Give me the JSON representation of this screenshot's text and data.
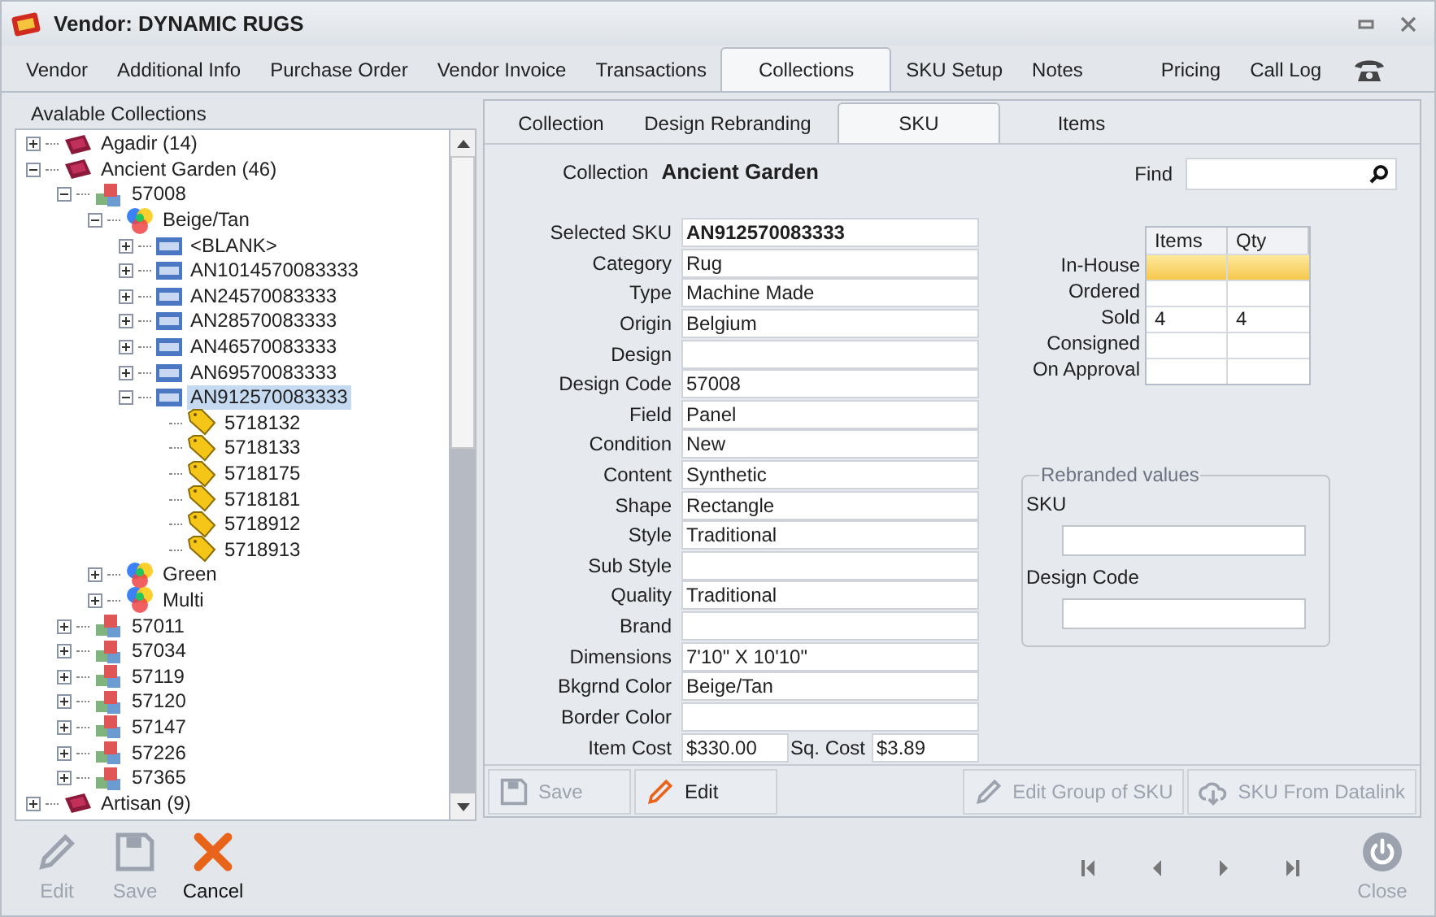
{
  "window": {
    "title": "Vendor: DYNAMIC RUGS"
  },
  "tabs": [
    {
      "label": "Vendor",
      "selected": false
    },
    {
      "label": "Additional Info",
      "selected": false
    },
    {
      "label": "Purchase Order",
      "selected": false
    },
    {
      "label": "Vendor Invoice",
      "selected": false
    },
    {
      "label": "Transactions",
      "selected": false
    },
    {
      "label": "Collections",
      "selected": true
    },
    {
      "label": "SKU Setup",
      "selected": false
    },
    {
      "label": "Notes",
      "selected": false
    },
    {
      "label": "Pricing",
      "selected": false
    },
    {
      "label": "Call Log",
      "selected": false
    }
  ],
  "tree": {
    "title": "Avalable Collections",
    "items": [
      {
        "kind": "collection",
        "label": "Agadir (14)",
        "expanded": false,
        "selected": false
      },
      {
        "kind": "collection",
        "label": "Ancient Garden (46)",
        "expanded": true,
        "selected": false,
        "children": [
          {
            "kind": "design",
            "label": "57008",
            "expanded": true,
            "selected": false,
            "children": [
              {
                "kind": "color",
                "label": "Beige/Tan",
                "expanded": true,
                "selected": false,
                "children": [
                  {
                    "kind": "sku",
                    "label": "<BLANK>",
                    "expanded": false,
                    "selected": false
                  },
                  {
                    "kind": "sku",
                    "label": "AN1014570083333",
                    "expanded": false,
                    "selected": false
                  },
                  {
                    "kind": "sku",
                    "label": "AN24570083333",
                    "expanded": false,
                    "selected": false
                  },
                  {
                    "kind": "sku",
                    "label": "AN28570083333",
                    "expanded": false,
                    "selected": false
                  },
                  {
                    "kind": "sku",
                    "label": "AN46570083333",
                    "expanded": false,
                    "selected": false
                  },
                  {
                    "kind": "sku",
                    "label": "AN69570083333",
                    "expanded": false,
                    "selected": false
                  },
                  {
                    "kind": "sku",
                    "label": "AN912570083333",
                    "expanded": true,
                    "selected": true,
                    "children": [
                      {
                        "kind": "item",
                        "label": "5718132",
                        "selected": false
                      },
                      {
                        "kind": "item",
                        "label": "5718133",
                        "selected": false
                      },
                      {
                        "kind": "item",
                        "label": "5718175",
                        "selected": false
                      },
                      {
                        "kind": "item",
                        "label": "5718181",
                        "selected": false
                      },
                      {
                        "kind": "item",
                        "label": "5718912",
                        "selected": false
                      },
                      {
                        "kind": "item",
                        "label": "5718913",
                        "selected": false
                      }
                    ]
                  }
                ]
              },
              {
                "kind": "color",
                "label": "Green",
                "expanded": false,
                "selected": false
              },
              {
                "kind": "color",
                "label": "Multi",
                "expanded": false,
                "selected": false
              }
            ]
          },
          {
            "kind": "design",
            "label": "57011",
            "expanded": false,
            "selected": false
          },
          {
            "kind": "design",
            "label": "57034",
            "expanded": false,
            "selected": false
          },
          {
            "kind": "design",
            "label": "57119",
            "expanded": false,
            "selected": false
          },
          {
            "kind": "design",
            "label": "57120",
            "expanded": false,
            "selected": false
          },
          {
            "kind": "design",
            "label": "57147",
            "expanded": false,
            "selected": false
          },
          {
            "kind": "design",
            "label": "57226",
            "expanded": false,
            "selected": false
          },
          {
            "kind": "design",
            "label": "57365",
            "expanded": false,
            "selected": false
          }
        ]
      },
      {
        "kind": "collection",
        "label": "Artisan (9)",
        "expanded": false,
        "selected": false
      }
    ]
  },
  "subtabs": [
    {
      "label": "Collection",
      "selected": false
    },
    {
      "label": "Design Rebranding",
      "selected": false
    },
    {
      "label": "SKU",
      "selected": true
    },
    {
      "label": "Items",
      "selected": false
    }
  ],
  "collection": {
    "label": "Collection",
    "value": "Ancient Garden"
  },
  "find": {
    "label": "Find"
  },
  "fields": [
    {
      "label": "Selected SKU",
      "value": "AN912570083333",
      "bold": true
    },
    {
      "label": "Category",
      "value": "Rug"
    },
    {
      "label": "Type",
      "value": "Machine Made"
    },
    {
      "label": "Origin",
      "value": "Belgium"
    },
    {
      "label": "Design"
    },
    {
      "label": "Design Code",
      "value": "57008"
    },
    {
      "label": "Field",
      "value": "Panel"
    },
    {
      "label": "Condition",
      "value": "New"
    },
    {
      "label": "Content",
      "value": "Synthetic"
    },
    {
      "label": "Shape",
      "value": "Rectangle"
    },
    {
      "label": "Style",
      "value": "Traditional"
    },
    {
      "label": "Sub Style"
    },
    {
      "label": "Quality",
      "value": "Traditional"
    },
    {
      "label": "Brand"
    },
    {
      "label": "Dimensions",
      "value": "7'10\" X 10'10\""
    },
    {
      "label": "Bkgrnd Color",
      "value": "Beige/Tan"
    },
    {
      "label": "Border Color"
    }
  ],
  "costs": [
    {
      "label": "Item Cost",
      "value": "$330.00"
    },
    {
      "label": "Sq. Cost",
      "value": "$3.89"
    }
  ],
  "stock": {
    "columns": [
      "Items",
      "Qty"
    ],
    "rows": [
      {
        "label": "In-House",
        "selected": true
      },
      {
        "label": "Ordered",
        "selected": false
      },
      {
        "label": "Sold",
        "items": "4",
        "qty": "4",
        "selected": false
      },
      {
        "label": "Consigned",
        "selected": false
      },
      {
        "label": "On Approval",
        "selected": false
      }
    ]
  },
  "rebranded": {
    "title": "Rebranded values",
    "fields": [
      "SKU",
      "Design Code"
    ]
  },
  "actions": [
    {
      "kind": "save",
      "label": "Save",
      "disabled": true
    },
    {
      "kind": "edit",
      "label": "Edit",
      "disabled": false
    },
    {
      "kind": "edit-group",
      "label": "Edit Group of SKU",
      "disabled": true
    },
    {
      "kind": "datalink",
      "label": "SKU From Datalink",
      "disabled": true
    }
  ],
  "toolbar": [
    {
      "kind": "edit",
      "label": "Edit",
      "disabled": true
    },
    {
      "kind": "save",
      "label": "Save",
      "disabled": true
    },
    {
      "kind": "cancel",
      "label": "Cancel",
      "disabled": false
    }
  ],
  "close": {
    "label": "Close",
    "disabled": true
  }
}
